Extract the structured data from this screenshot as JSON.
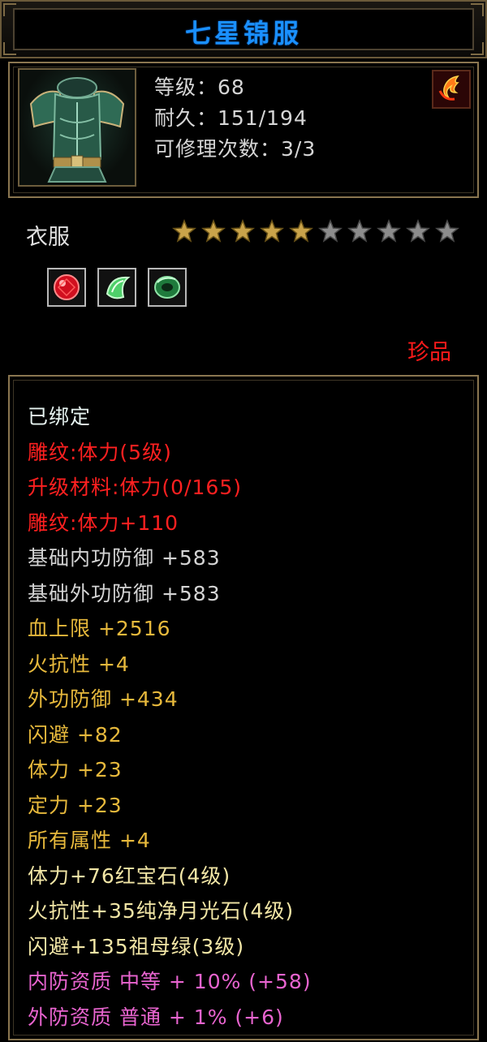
{
  "title": "七星锦服",
  "item": {
    "level": "等级：68",
    "durability": "耐久：151/194",
    "repair": "可修理次数：3/3",
    "icon_name": "armor-icon",
    "badge_icon": "fire-element-icon"
  },
  "type_label": "衣服",
  "stars": {
    "filled": 5,
    "total": 10,
    "filled_color": "#c9a34a",
    "empty_color": "#8c8c8c"
  },
  "gems": [
    "ruby-gem-icon",
    "moonstone-gem-icon",
    "emerald-gem-icon"
  ],
  "rarity": "珍品",
  "attributes": [
    {
      "text": "已绑定",
      "color": "white"
    },
    {
      "text": "雕纹:体力(5级)",
      "color": "red"
    },
    {
      "text": "升级材料:体力(0/165)",
      "color": "red"
    },
    {
      "text": "雕纹:体力+110",
      "color": "red"
    },
    {
      "text": "基础内功防御 +583",
      "color": "gray"
    },
    {
      "text": "基础外功防御 +583",
      "color": "gray"
    },
    {
      "text": "血上限 +2516",
      "color": "gold"
    },
    {
      "text": "火抗性 +4",
      "color": "gold"
    },
    {
      "text": "外功防御 +434",
      "color": "gold"
    },
    {
      "text": "闪避 +82",
      "color": "gold"
    },
    {
      "text": "体力 +23",
      "color": "gold"
    },
    {
      "text": "定力 +23",
      "color": "gold"
    },
    {
      "text": "所有属性 +4",
      "color": "gold"
    },
    {
      "text": "体力+76红宝石(4级)",
      "color": "lightgold"
    },
    {
      "text": "火抗性+35纯净月光石(4级)",
      "color": "lightgold"
    },
    {
      "text": "闪避+135祖母绿(3级)",
      "color": "lightgold"
    },
    {
      "text": "内防资质 中等 + 10% (+58)",
      "color": "pink"
    },
    {
      "text": "外防资质 普通 + 1% (+6)",
      "color": "pink"
    }
  ]
}
